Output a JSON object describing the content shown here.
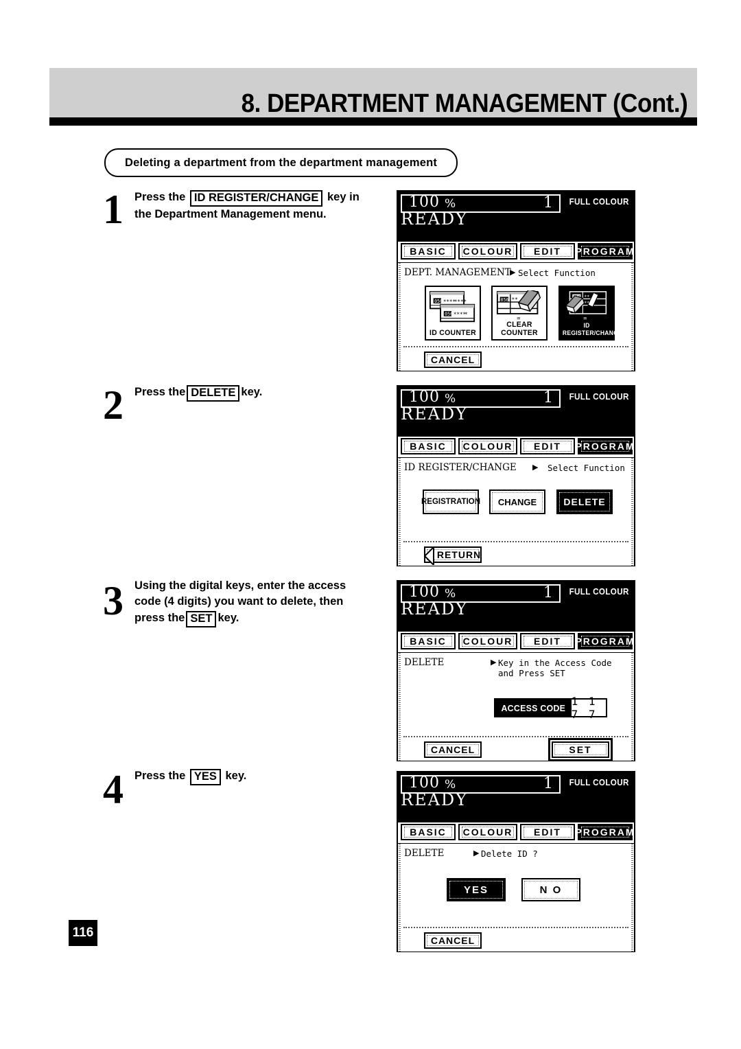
{
  "header": {
    "title": "8. DEPARTMENT MANAGEMENT (Cont.)"
  },
  "section": {
    "capsule_label": "Deleting a department from the department management"
  },
  "page_number": "116",
  "steps": [
    {
      "number": "1",
      "lines": [
        {
          "before": "Press the ",
          "key": "ID REGISTER/CHANGE",
          "after": " key in"
        },
        {
          "before": "the Department Management menu.",
          "key": "",
          "after": ""
        }
      ]
    },
    {
      "number": "2",
      "lines": [
        {
          "before": "Press the",
          "key": "DELETE",
          "after": "key."
        }
      ]
    },
    {
      "number": "3",
      "lines": [
        {
          "before": "Using  the  digital  keys,  enter  the  access",
          "key": "",
          "after": ""
        },
        {
          "before": "code (4 digits) you want to delete, then",
          "key": "",
          "after": ""
        },
        {
          "before": "press the",
          "key": "SET",
          "after": "key."
        }
      ]
    },
    {
      "number": "4",
      "lines": [
        {
          "before": "Press the ",
          "key": "YES",
          "after": " key."
        }
      ]
    }
  ],
  "lcd_common": {
    "zoom_value": "100",
    "percent_symbol": "%",
    "copy_count": "1",
    "colour_mode": "FULL COLOUR",
    "status": "READY",
    "tabs": [
      {
        "label": "BASIC",
        "selected": false
      },
      {
        "label": "COLOUR",
        "selected": false
      },
      {
        "label": "EDIT",
        "selected": false
      },
      {
        "label": "PROGRAM",
        "selected": true
      }
    ]
  },
  "panels": [
    {
      "id": "dept-management",
      "crumb_left": "DEPT. MANAGEMENT",
      "crumb_arrow": "▶",
      "crumb_right": "Select Function",
      "tiles": [
        {
          "label": "ID COUNTER",
          "icon": "id-counter-icon",
          "selected": false
        },
        {
          "label": "CLEAR COUNTER",
          "icon": "clear-counter-icon",
          "selected": false
        },
        {
          "label": "ID REGISTER/CHANGE",
          "icon": "id-register-change-icon",
          "selected": true
        }
      ],
      "footer_buttons": [
        {
          "label": "CANCEL",
          "style": "normal"
        }
      ]
    },
    {
      "id": "id-register-change",
      "crumb_left": "ID REGISTER/CHANGE",
      "crumb_arrow": "▶",
      "crumb_right": "Select Function",
      "buttons": [
        {
          "label": "REGISTRATION",
          "selected": false
        },
        {
          "label": "CHANGE",
          "selected": false
        },
        {
          "label": "DELETE",
          "selected": true
        }
      ],
      "footer_buttons": [
        {
          "label": "RETURN",
          "style": "return"
        }
      ]
    },
    {
      "id": "delete-access-code",
      "crumb_left": "DELETE",
      "crumb_arrow": "▶",
      "crumb_right_line1": "Key in the Access Code",
      "crumb_right_line2": "and Press SET",
      "access_code": {
        "label": "ACCESS CODE",
        "value": "1 1 7 7"
      },
      "footer_buttons": [
        {
          "label": "CANCEL",
          "style": "normal"
        },
        {
          "label": "SET",
          "style": "emphasized"
        }
      ]
    },
    {
      "id": "delete-confirm",
      "crumb_left": "DELETE",
      "crumb_arrow": "▶",
      "crumb_right": "Delete ID ?",
      "buttons": [
        {
          "label": "YES",
          "selected": true
        },
        {
          "label": "N O",
          "selected": false
        }
      ],
      "footer_buttons": [
        {
          "label": "CANCEL",
          "style": "normal"
        }
      ]
    }
  ]
}
